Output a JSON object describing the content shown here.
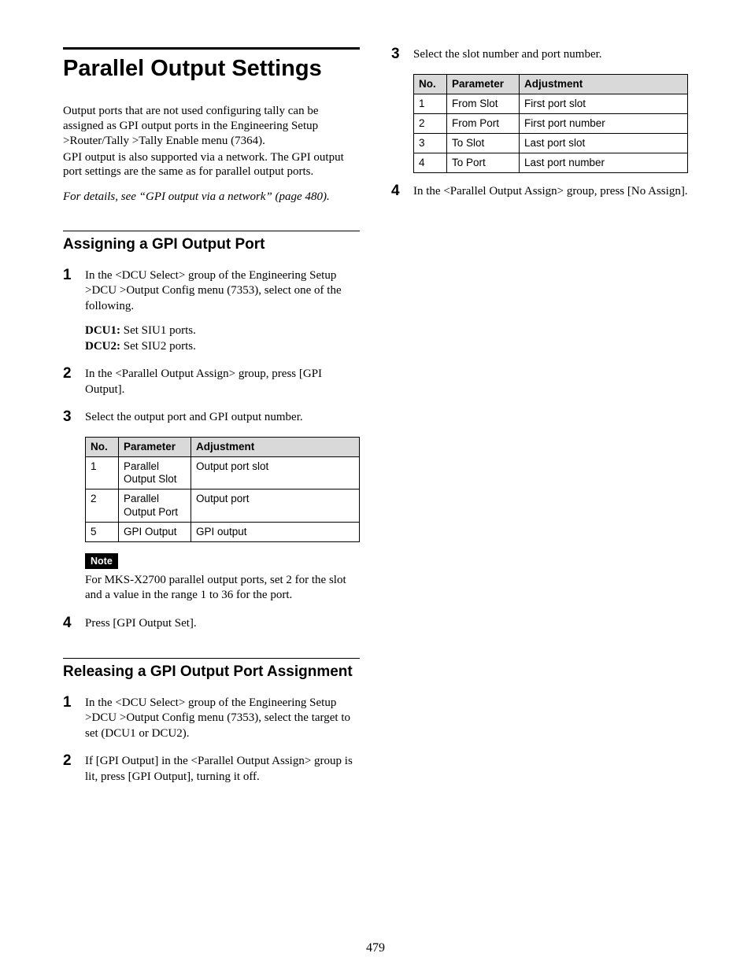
{
  "page_number": "479",
  "title": "Parallel Output Settings",
  "intro_p1": "Output ports that are not used configuring tally can be assigned as GPI output ports in the Engineering Setup >Router/Tally >Tally Enable menu (7364).",
  "intro_p2": "GPI output is also supported via a network. The GPI output port settings are the same as for parallel output ports.",
  "intro_ref": "For details, see “GPI output via a network” (page 480).",
  "section_assign": {
    "heading": "Assigning a GPI Output Port",
    "step1": "In the <DCU Select> group of the Engineering Setup >DCU >Output Config menu (7353), select one of the following.",
    "dcu1_label": "DCU1:",
    "dcu1_text": " Set SIU1 ports.",
    "dcu2_label": "DCU2:",
    "dcu2_text": " Set SIU2 ports.",
    "step2": "In the <Parallel Output Assign> group, press [GPI Output].",
    "step3": "Select the output port and GPI output number.",
    "table_headers": {
      "no": "No.",
      "param": "Parameter",
      "adj": "Adjustment"
    },
    "table_rows": [
      {
        "no": "1",
        "param": "Parallel Output Slot",
        "adj": "Output port slot"
      },
      {
        "no": "2",
        "param": "Parallel Output Port",
        "adj": "Output port"
      },
      {
        "no": "5",
        "param": "GPI Output",
        "adj": "GPI output"
      }
    ],
    "note_label": "Note",
    "note_text": "For MKS-X2700 parallel output ports, set 2 for the slot and a value in the range 1 to 36 for the port.",
    "step4": "Press [GPI Output Set]."
  },
  "section_release": {
    "heading": "Releasing a GPI Output Port Assignment",
    "step1": "In the <DCU Select> group of the Engineering Setup >DCU >Output Config menu (7353), select the target to set (DCU1 or DCU2).",
    "step2": "If [GPI Output] in the <Parallel Output Assign> group is lit, press [GPI Output], turning it off.",
    "step3": "Select the slot number and port number.",
    "table_headers": {
      "no": "No.",
      "param": "Parameter",
      "adj": "Adjustment"
    },
    "table_rows": [
      {
        "no": "1",
        "param": "From Slot",
        "adj": "First port slot"
      },
      {
        "no": "2",
        "param": "From Port",
        "adj": "First port number"
      },
      {
        "no": "3",
        "param": "To Slot",
        "adj": "Last port slot"
      },
      {
        "no": "4",
        "param": "To Port",
        "adj": "Last port number"
      }
    ],
    "step4": "In the <Parallel Output Assign> group, press [No Assign]."
  }
}
